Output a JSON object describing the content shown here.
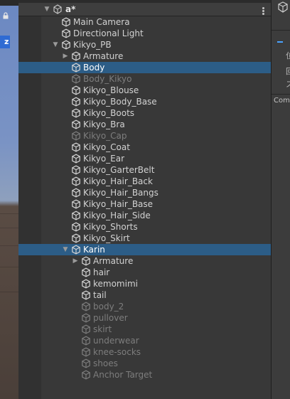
{
  "scene": {
    "badge": "z",
    "lock_icon": "lock-icon"
  },
  "hierarchy": {
    "scene_name": "a*",
    "items": [
      {
        "label": "Main Camera",
        "depth": 0,
        "arrow": "",
        "state": "normal"
      },
      {
        "label": "Directional Light",
        "depth": 0,
        "arrow": "",
        "state": "normal"
      },
      {
        "label": "Kikyo_PB",
        "depth": 0,
        "arrow": "expanded",
        "state": "normal"
      },
      {
        "label": "Armature",
        "depth": 1,
        "arrow": "collapsed",
        "state": "normal"
      },
      {
        "label": "Body",
        "depth": 1,
        "arrow": "",
        "state": "selected"
      },
      {
        "label": "Body_Kikyo",
        "depth": 1,
        "arrow": "",
        "state": "inactive"
      },
      {
        "label": "Kikyo_Blouse",
        "depth": 1,
        "arrow": "",
        "state": "normal"
      },
      {
        "label": "Kikyo_Body_Base",
        "depth": 1,
        "arrow": "",
        "state": "normal"
      },
      {
        "label": "Kikyo_Boots",
        "depth": 1,
        "arrow": "",
        "state": "normal"
      },
      {
        "label": "Kikyo_Bra",
        "depth": 1,
        "arrow": "",
        "state": "normal"
      },
      {
        "label": "Kikyo_Cap",
        "depth": 1,
        "arrow": "",
        "state": "inactive"
      },
      {
        "label": "Kikyo_Coat",
        "depth": 1,
        "arrow": "",
        "state": "normal"
      },
      {
        "label": "Kikyo_Ear",
        "depth": 1,
        "arrow": "",
        "state": "normal"
      },
      {
        "label": "Kikyo_GarterBelt",
        "depth": 1,
        "arrow": "",
        "state": "normal"
      },
      {
        "label": "Kikyo_Hair_Back",
        "depth": 1,
        "arrow": "",
        "state": "normal"
      },
      {
        "label": "Kikyo_Hair_Bangs",
        "depth": 1,
        "arrow": "",
        "state": "normal"
      },
      {
        "label": "Kikyo_Hair_Base",
        "depth": 1,
        "arrow": "",
        "state": "normal"
      },
      {
        "label": "Kikyo_Hair_Side",
        "depth": 1,
        "arrow": "",
        "state": "normal"
      },
      {
        "label": "Kikyo_Shorts",
        "depth": 1,
        "arrow": "",
        "state": "normal"
      },
      {
        "label": "Kikyo_Skirt",
        "depth": 1,
        "arrow": "",
        "state": "normal"
      },
      {
        "label": "Karin",
        "depth": 1,
        "arrow": "expanded",
        "state": "selected"
      },
      {
        "label": "Armature",
        "depth": 2,
        "arrow": "collapsed",
        "state": "normal"
      },
      {
        "label": "hair",
        "depth": 2,
        "arrow": "",
        "state": "normal"
      },
      {
        "label": "kemomimi",
        "depth": 2,
        "arrow": "",
        "state": "normal"
      },
      {
        "label": "tail",
        "depth": 2,
        "arrow": "",
        "state": "normal"
      },
      {
        "label": "body_2",
        "depth": 2,
        "arrow": "",
        "state": "inactive"
      },
      {
        "label": "pullover",
        "depth": 2,
        "arrow": "",
        "state": "inactive"
      },
      {
        "label": "skirt",
        "depth": 2,
        "arrow": "",
        "state": "inactive"
      },
      {
        "label": "underwear",
        "depth": 2,
        "arrow": "",
        "state": "inactive"
      },
      {
        "label": "knee-socks",
        "depth": 2,
        "arrow": "",
        "state": "inactive"
      },
      {
        "label": "shoes",
        "depth": 2,
        "arrow": "",
        "state": "inactive"
      },
      {
        "label": "Anchor Target",
        "depth": 2,
        "arrow": "",
        "state": "inactive"
      }
    ]
  },
  "inspector": {
    "glyphs": [
      "位",
      "回",
      "ス"
    ],
    "component_label": "Com"
  },
  "colors": {
    "selected_row": "#2c5d87",
    "text": "#d2d2d2",
    "inactive_text": "#7d7d7d",
    "badge_blue": "#2f6bd3"
  }
}
